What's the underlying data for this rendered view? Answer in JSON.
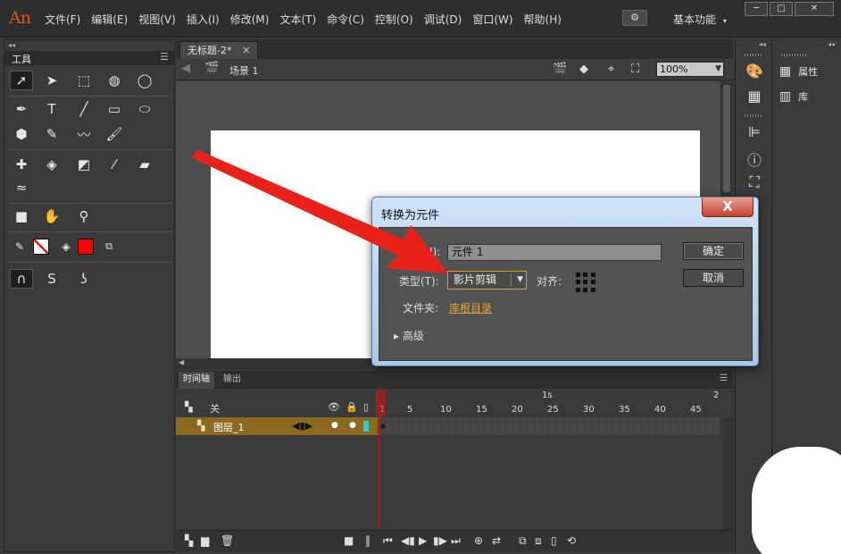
{
  "app": {
    "logo": "An",
    "menu": [
      "文件(F)",
      "编辑(E)",
      "视图(V)",
      "插入(I)",
      "修改(M)",
      "文本(T)",
      "命令(C)",
      "控制(O)",
      "调试(D)",
      "窗口(W)",
      "帮助(H)"
    ],
    "workspace": "基本功能",
    "window_controls": {
      "min": "─",
      "max": "□",
      "close": "✕"
    }
  },
  "tools_panel": {
    "collapse": "◂◂",
    "title": "工具",
    "menu_icon": "☰"
  },
  "document": {
    "tab_title": "无标题-2*",
    "tab_close": "✕",
    "scene_label": "场景 1",
    "zoom": "100%"
  },
  "timeline": {
    "tab_timeline": "时间轴",
    "tab_output": "输出",
    "header_label": "关",
    "ruler_second": "1s",
    "ruler_two": "2",
    "frame_numbers": [
      "1",
      "5",
      "10",
      "15",
      "20",
      "25",
      "30",
      "35",
      "40",
      "45"
    ],
    "layer_name": "图层_1"
  },
  "right_panels": {
    "collapse": "◂◂",
    "properties_label": "属性",
    "library_label": "库"
  },
  "dialog": {
    "title": "转换为元件",
    "close": "X",
    "name_label": "(N):",
    "name_value": "元件 1",
    "type_label": "类型(T):",
    "type_value": "影片剪辑",
    "align_label": "对齐:",
    "folder_label": "文件夹:",
    "folder_value": "库根目录",
    "advanced_label": "▸ 高级",
    "ok_label": "确定",
    "cancel_label": "取消"
  },
  "colors": {
    "accent_orange": "#d9a526",
    "annotation_red": "#e8211a",
    "layer_selected": "#8a6a1e",
    "fill_color": "#ff0000"
  }
}
